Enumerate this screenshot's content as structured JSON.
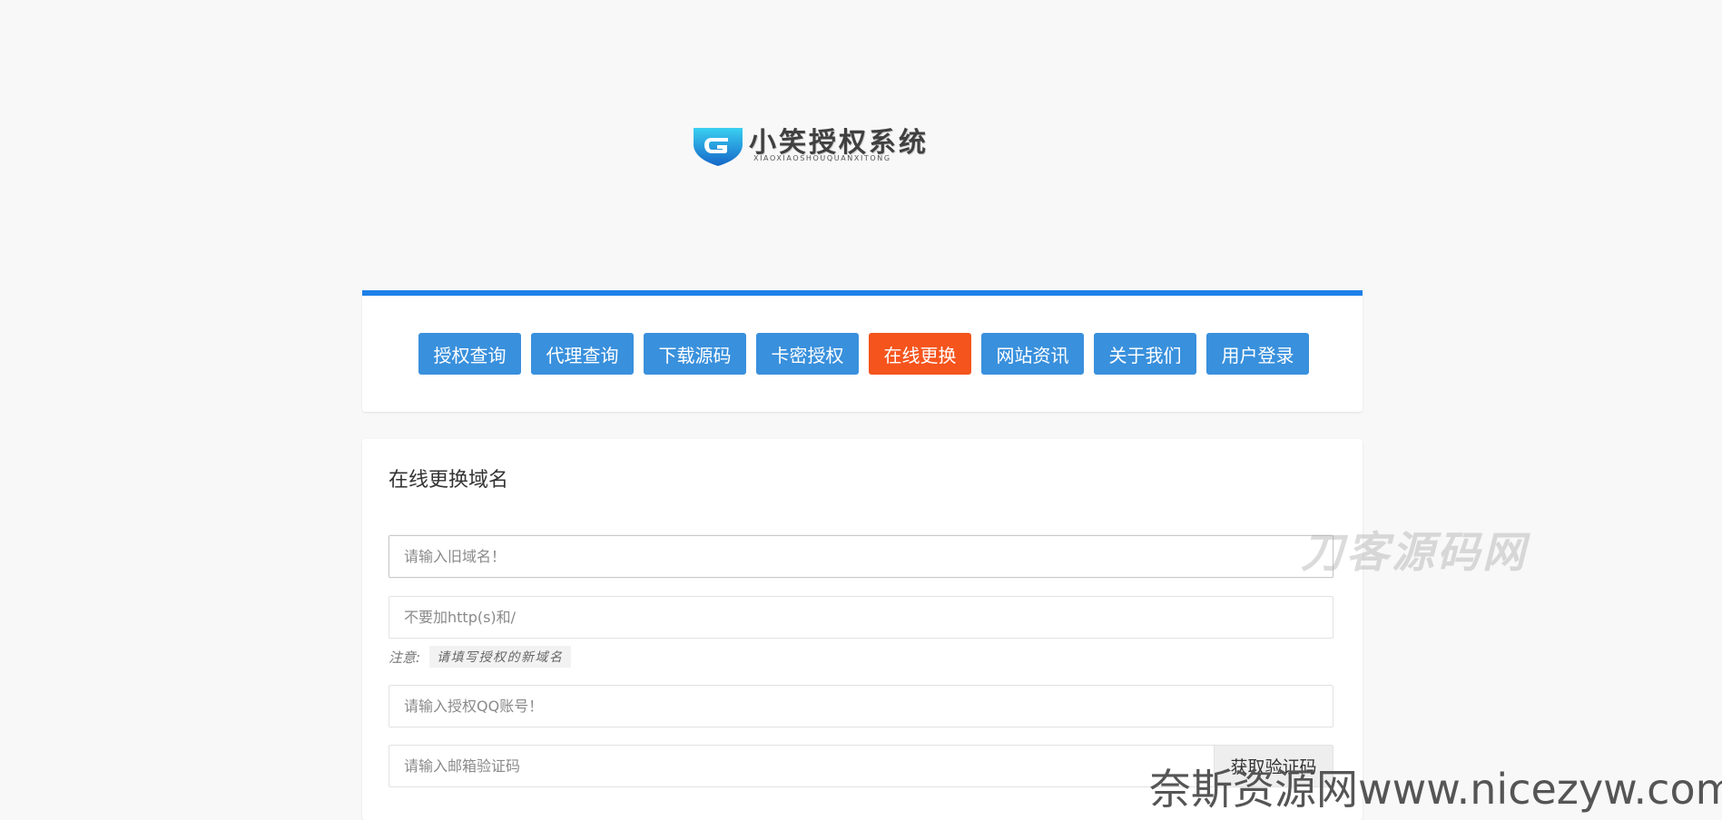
{
  "logo": {
    "title": "小笑授权系统",
    "subtitle": "XIAOXIAOSHOUQUANXITONG"
  },
  "colors": {
    "accent": "#1e80e8",
    "nav_button": "#3990dc",
    "nav_active": "#f5541d",
    "background": "#f8f8f8"
  },
  "nav": {
    "items": [
      {
        "label": "授权查询"
      },
      {
        "label": "代理查询"
      },
      {
        "label": "下载源码"
      },
      {
        "label": "卡密授权"
      },
      {
        "label": "在线更换",
        "active": true
      },
      {
        "label": "网站资讯"
      },
      {
        "label": "关于我们"
      },
      {
        "label": "用户登录"
      }
    ]
  },
  "form": {
    "title": "在线更换域名",
    "old_domain": {
      "placeholder": "请输入旧域名！",
      "value": ""
    },
    "new_domain": {
      "placeholder": "不要加http(s)和/",
      "value": ""
    },
    "note_label": "注意:",
    "note_text": "请填写授权的新域名",
    "qq": {
      "placeholder": "请输入授权QQ账号！",
      "value": ""
    },
    "email_code": {
      "placeholder": "请输入邮箱验证码",
      "value": ""
    },
    "get_code_button": "获取验证码"
  },
  "watermarks": {
    "top": "刀客源码网",
    "bottom": "奈斯资源网www.nicezyw.com"
  }
}
